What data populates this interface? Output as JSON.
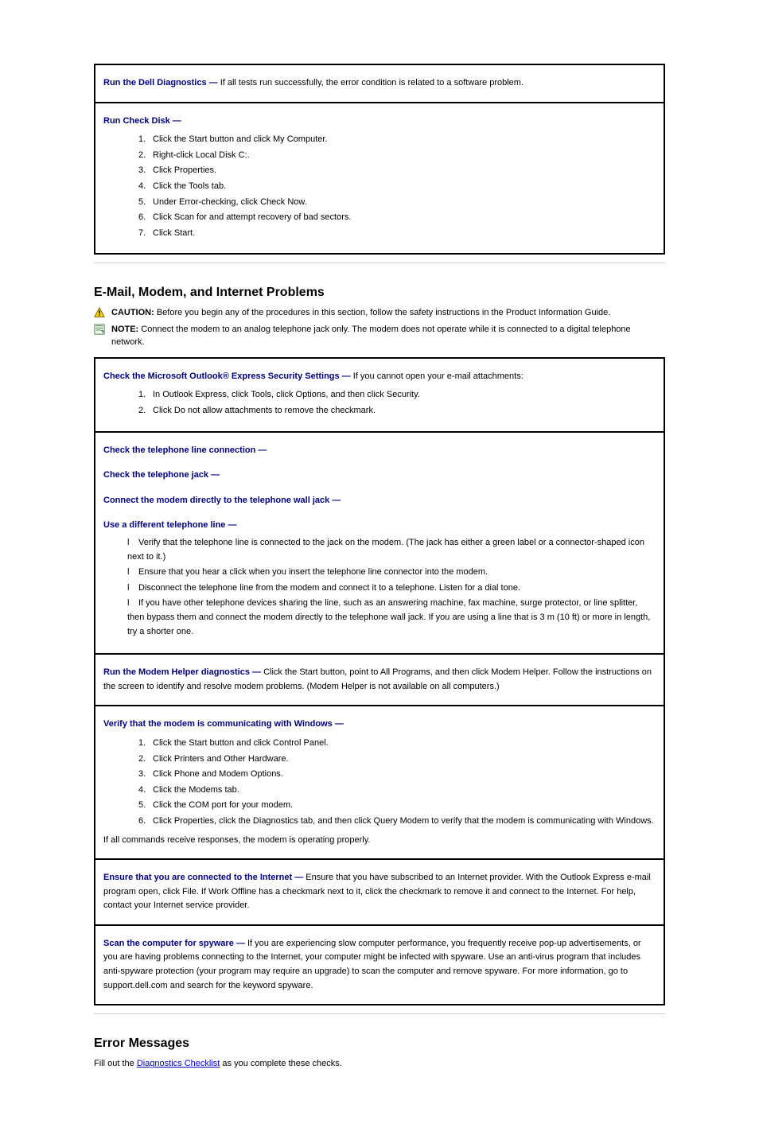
{
  "box1": {
    "r1": {
      "lead": "Run the Dell Diagnostics —",
      "body": " If all tests run successfully, the error condition is related to a software problem."
    },
    "r2": {
      "lead": "Run Check Disk —",
      "steps": [
        "Click the Start button and click My Computer.",
        "Right-click Local Disk C:.",
        "Click Properties.",
        "Click the Tools tab.",
        "Under Error-checking, click Check Now.",
        "Click Scan for and attempt recovery of bad sectors.",
        "Click Start."
      ]
    }
  },
  "section1": {
    "title": "E-Mail, Modem, and Internet Problems",
    "caution": {
      "label": "CAUTION: ",
      "body": "Before you begin any of the procedures in this section, follow the safety instructions in the Product Information Guide."
    },
    "note": {
      "label": "NOTE: ",
      "body": "Connect the modem to an analog telephone jack only. The modem does not operate while it is connected to a digital telephone network."
    }
  },
  "box2": {
    "r1": {
      "lead_pre": "Check the Microsoft Outlook",
      "lead_sup": "®",
      "lead_post": " Express Security Settings —",
      "body": " If you cannot open your e-mail attachments:",
      "steps": [
        "In Outlook Express, click Tools, click Options, and then click Security.",
        "Click Do not allow attachments to remove the checkmark."
      ]
    },
    "r2": {
      "l1": "Check the telephone line connection —",
      "l2": "Check the telephone jack —",
      "l3": "Connect the modem directly to the telephone wall jack —",
      "l4": "Use a different telephone line —",
      "bullets": [
        "Verify that the telephone line is connected to the jack on the modem. (The jack has either a green label or a connector-shaped icon next to it.)",
        "Ensure that you hear a click when you insert the telephone line connector into the modem.",
        "Disconnect the telephone line from the modem and connect it to a telephone. Listen for a dial tone.",
        "If you have other telephone devices sharing the line, such as an answering machine, fax machine, surge protector, or line splitter, then bypass them and connect the modem directly to the telephone wall jack. If you are using a line that is 3 m (10 ft) or more in length, try a shorter one."
      ]
    },
    "r3": {
      "lead": "Run the Modem Helper diagnostics —",
      "body": " Click the Start button, point to All Programs, and then click Modem Helper. Follow the instructions on the screen to identify and resolve modem problems. (Modem Helper is not available on all computers.)"
    },
    "r4": {
      "lead": "Verify that the modem is communicating with Windows —",
      "steps": [
        "Click the Start button and click Control Panel.",
        "Click Printers and Other Hardware.",
        "Click Phone and Modem Options.",
        "Click the Modems tab.",
        "Click the COM port for your modem.",
        "Click Properties, click the Diagnostics tab, and then click Query Modem to verify that the modem is communicating with Windows."
      ],
      "tail": "If all commands receive responses, the modem is operating properly."
    },
    "r5": {
      "lead": "Ensure that you are connected to the Internet —",
      "body": " Ensure that you have subscribed to an Internet provider. With the Outlook Express e-mail program open, click File. If Work Offline has a checkmark next to it, click the checkmark to remove it and connect to the Internet. For help, contact your Internet service provider."
    },
    "r6": {
      "lead": "Scan the computer for spyware —",
      "body": " If you are experiencing slow computer performance, you frequently receive pop-up advertisements, or you are having problems connecting to the Internet, your computer might be infected with spyware. Use an anti-virus program that includes anti-spyware protection (your program may require an upgrade) to scan the computer and remove spyware. For more information, go to support.dell.com and search for the keyword spyware."
    }
  },
  "section2": {
    "title": "Error Messages",
    "intro_pre": "Fill out the ",
    "intro_link": "Diagnostics Checklist",
    "intro_post": " as you complete these checks."
  }
}
